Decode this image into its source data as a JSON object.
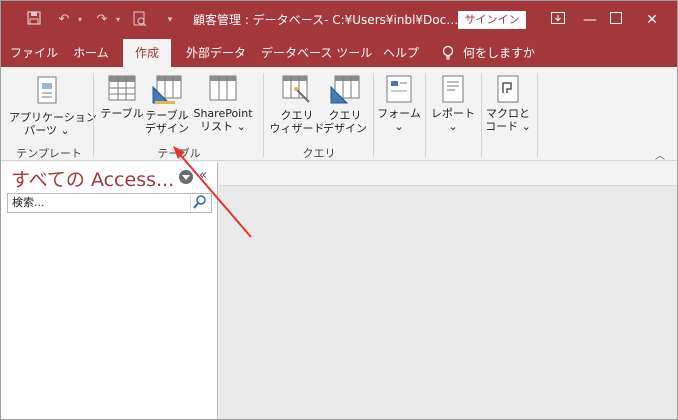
{
  "titlebar": {
    "title": "顧客管理 : データベース- C:¥Users¥inbl¥Doc…",
    "signin_label": "サインイン",
    "bg_color": "#a4373a"
  },
  "qat": {
    "save_icon": "save-icon",
    "undo_icon": "undo-icon",
    "redo_icon": "redo-icon",
    "print_preview_icon": "print-preview-icon"
  },
  "tabs": [
    {
      "label": "ファイル"
    },
    {
      "label": "ホーム"
    },
    {
      "label": "作成",
      "active": true
    },
    {
      "label": "外部データ"
    },
    {
      "label": "データベース ツール"
    },
    {
      "label": "ヘルプ"
    },
    {
      "label": "何をしますか"
    }
  ],
  "ribbon": {
    "app_parts": {
      "line1": "アプリケーション",
      "line2": "パーツ ⌄"
    },
    "table": {
      "line1": "テーブル"
    },
    "table_design": {
      "line1": "テーブル",
      "line2": "デザイン"
    },
    "sharepoint": {
      "line1": "SharePoint",
      "line2": "リスト ⌄"
    },
    "query_wizard": {
      "line1": "クエリ",
      "line2": "ウィザード"
    },
    "query_design": {
      "line1": "クエリ",
      "line2": "デザイン"
    },
    "form": {
      "line1": "フォーム",
      "line2": "⌄"
    },
    "report": {
      "line1": "レポート",
      "line2": "⌄"
    },
    "macro": {
      "line1": "マクロと",
      "line2": "コード ⌄"
    },
    "groups": {
      "templates": "テンプレート",
      "tables": "テーブル",
      "queries": "クエリ"
    }
  },
  "navpane": {
    "title": "すべての Access...",
    "search_placeholder": "検索..."
  }
}
